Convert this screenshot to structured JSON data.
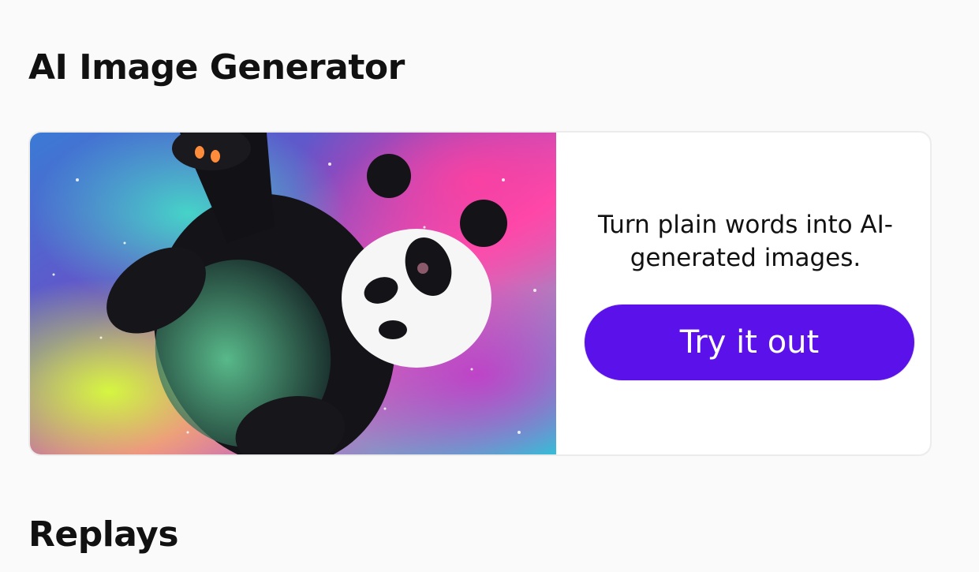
{
  "sections": {
    "ai_image_generator": {
      "title": "AI Image Generator",
      "card": {
        "image_alt": "panda-painting",
        "description": "Turn plain words into AI-generated images.",
        "button_label": "Try it out"
      }
    },
    "replays": {
      "title": "Replays"
    }
  },
  "colors": {
    "accent": "#5b12ea",
    "background": "#fafafa",
    "card_border": "#ececec"
  }
}
